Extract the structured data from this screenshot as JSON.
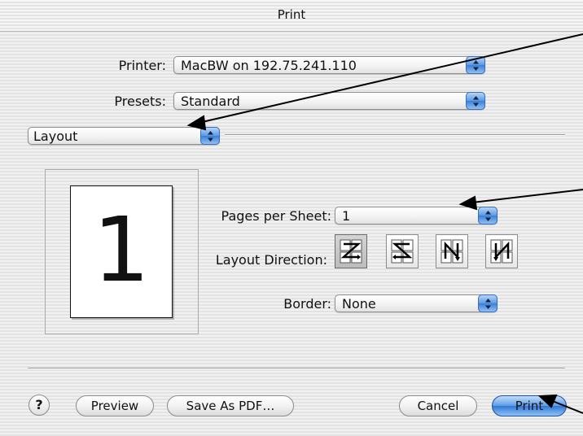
{
  "window": {
    "title": "Print"
  },
  "printer": {
    "label": "Printer:",
    "value": "MacBW on 192.75.241.110"
  },
  "presets": {
    "label": "Presets:",
    "value": "Standard"
  },
  "pane_menu": {
    "value": "Layout"
  },
  "preview": {
    "page_number": "1"
  },
  "pages_per_sheet": {
    "label": "Pages per Sheet:",
    "value": "1"
  },
  "layout_direction": {
    "label": "Layout Direction:",
    "options": [
      "left-to-right-then-down",
      "right-to-left-then-down",
      "top-to-bottom-then-right",
      "top-to-bottom-then-left"
    ],
    "selected": "left-to-right-then-down"
  },
  "border": {
    "label": "Border:",
    "value": "None"
  },
  "footer": {
    "help": "?",
    "preview": "Preview",
    "save_pdf": "Save As PDF…",
    "cancel": "Cancel",
    "print": "Print"
  },
  "colors": {
    "accent": "#3a7fd9",
    "background": "#ececec"
  }
}
